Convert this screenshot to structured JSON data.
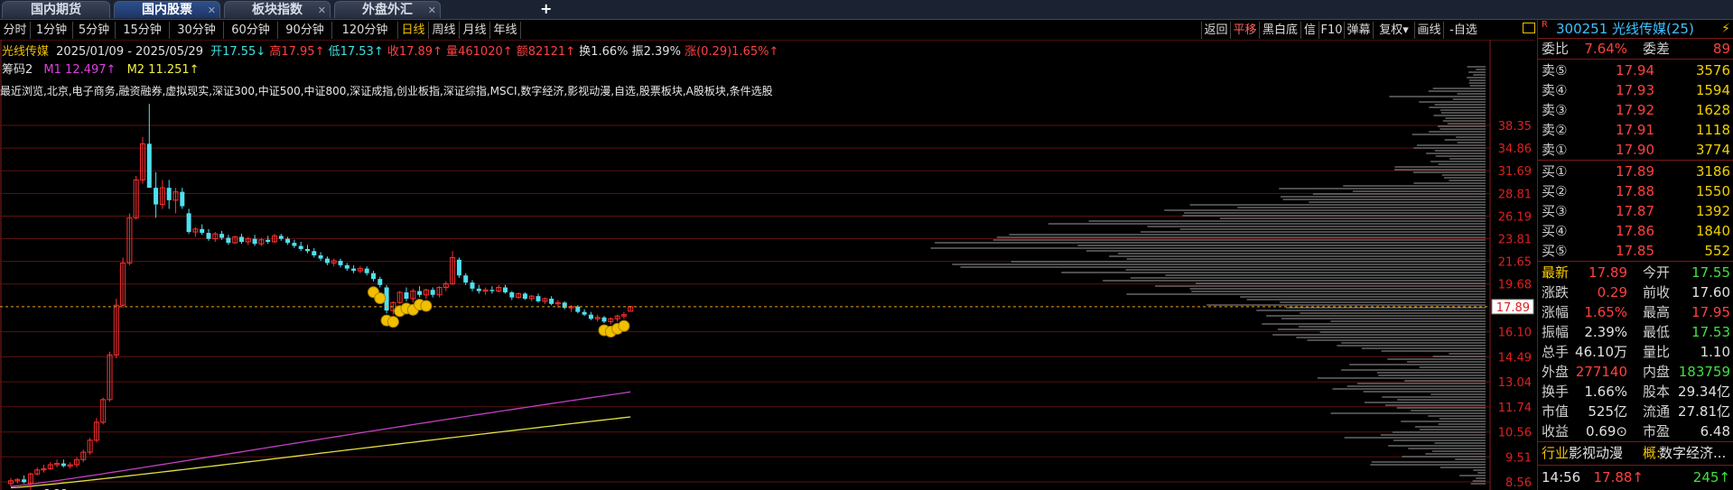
{
  "tabs": [
    {
      "label": "国内期货",
      "active": false,
      "closable": false
    },
    {
      "label": "国内股票",
      "active": true,
      "closable": true
    },
    {
      "label": "板块指数",
      "active": false,
      "closable": true
    },
    {
      "label": "外盘外汇",
      "active": false,
      "closable": true
    }
  ],
  "add_tab": "+",
  "periods": [
    "分时",
    "1分钟",
    "5分钟",
    "15分钟",
    "30分钟",
    "60分钟",
    "90分钟",
    "120分钟",
    "日线",
    "周线",
    "月线",
    "年线"
  ],
  "active_period": "日线",
  "tools": [
    "返回",
    "平移",
    "黑白底",
    "信",
    "F10",
    "弹幕",
    "复权▾",
    "画线",
    "-自选"
  ],
  "highlight_tool": "平移",
  "info": {
    "name": "光线传媒",
    "range": "2025/01/09 - 2025/05/29",
    "open": "开17.55↓",
    "high": "高17.95↑",
    "low": "低17.53↑",
    "close": "收17.89↑",
    "volume": "量461020↑",
    "amount": "额82121↑",
    "turnover": "换1.66%",
    "amplitude": "振2.39%",
    "change": "涨(0.29)1.65%↑"
  },
  "ma": {
    "label": "筹码2",
    "m1": "M1 12.497↑",
    "m2": "M2 11.251↑"
  },
  "blocks": "最近浏览,北京,电子商务,融资融券,虚拟现实,深证300,中证500,中证800,深证成指,创业板指,深证综指,MSCI,数字经济,影视动漫,自选,股票板块,A股板块,条件选股",
  "chart_data": {
    "type": "candlestick",
    "price_ticks": [
      "38.35",
      "34.86",
      "31.69",
      "28.81",
      "26.19",
      "23.81",
      "21.65",
      "19.68",
      "17.89",
      "16.10",
      "14.49",
      "13.04",
      "11.74",
      "10.56",
      "9.51",
      "8.56"
    ],
    "current_price": "17.89",
    "low_label": "8.28",
    "candles": [
      [
        8.5,
        8.7,
        8.4,
        8.6
      ],
      [
        8.6,
        8.7,
        8.5,
        8.65
      ],
      [
        8.65,
        8.8,
        8.5,
        8.55
      ],
      [
        8.5,
        8.9,
        8.28,
        8.85
      ],
      [
        8.85,
        9.1,
        8.8,
        9.0
      ],
      [
        9.0,
        9.2,
        8.9,
        9.05
      ],
      [
        9.05,
        9.3,
        9.0,
        9.2
      ],
      [
        9.2,
        9.4,
        9.1,
        9.25
      ],
      [
        9.25,
        9.4,
        9.1,
        9.15
      ],
      [
        9.15,
        9.3,
        9.05,
        9.2
      ],
      [
        9.2,
        9.5,
        9.1,
        9.4
      ],
      [
        9.4,
        9.8,
        9.3,
        9.7
      ],
      [
        9.7,
        10.3,
        9.6,
        10.2
      ],
      [
        10.2,
        11.2,
        10.1,
        11.0
      ],
      [
        11.0,
        12.2,
        10.9,
        12.1
      ],
      [
        12.1,
        14.8,
        12.0,
        14.6
      ],
      [
        14.6,
        18.5,
        14.4,
        18.0
      ],
      [
        18.0,
        22.0,
        17.8,
        21.5
      ],
      [
        21.5,
        26.5,
        21.3,
        26.0
      ],
      [
        26.0,
        31.0,
        25.8,
        30.5
      ],
      [
        30.5,
        36.5,
        30.0,
        35.5
      ],
      [
        35.5,
        42.0,
        34.0,
        29.5
      ],
      [
        29.5,
        31.5,
        26.0,
        27.5
      ],
      [
        27.5,
        30.5,
        27.0,
        29.5
      ],
      [
        29.5,
        30.5,
        27.0,
        28.0
      ],
      [
        28.0,
        29.5,
        26.5,
        29.0
      ],
      [
        29.0,
        29.5,
        27.0,
        27.3
      ],
      [
        26.5,
        27.0,
        24.3,
        24.5
      ],
      [
        24.5,
        25.0,
        24.0,
        24.8
      ],
      [
        24.8,
        25.3,
        24.2,
        24.4
      ],
      [
        24.4,
        24.8,
        23.6,
        23.8
      ],
      [
        23.8,
        24.5,
        23.5,
        24.3
      ],
      [
        24.3,
        24.6,
        23.7,
        23.9
      ],
      [
        23.9,
        24.2,
        23.2,
        23.4
      ],
      [
        23.4,
        24.1,
        23.3,
        24.0
      ],
      [
        24.0,
        24.3,
        23.3,
        23.5
      ],
      [
        23.5,
        24.0,
        23.2,
        23.8
      ],
      [
        23.8,
        24.2,
        23.1,
        23.3
      ],
      [
        23.3,
        23.9,
        23.1,
        23.7
      ],
      [
        23.7,
        24.1,
        23.3,
        23.5
      ],
      [
        23.5,
        24.3,
        23.4,
        24.1
      ],
      [
        24.1,
        24.3,
        23.6,
        23.8
      ],
      [
        23.8,
        24.0,
        23.2,
        23.4
      ],
      [
        23.4,
        23.7,
        22.9,
        23.1
      ],
      [
        23.1,
        23.5,
        22.6,
        22.8
      ],
      [
        22.8,
        23.2,
        22.4,
        22.6
      ],
      [
        22.6,
        22.9,
        22.0,
        22.2
      ],
      [
        22.2,
        22.5,
        21.7,
        21.9
      ],
      [
        21.9,
        22.1,
        21.3,
        21.5
      ],
      [
        21.5,
        21.9,
        21.2,
        21.7
      ],
      [
        21.7,
        21.9,
        21.1,
        21.3
      ],
      [
        21.3,
        21.5,
        20.8,
        21.0
      ],
      [
        21.0,
        21.3,
        20.6,
        20.8
      ],
      [
        20.8,
        21.2,
        20.6,
        21.0
      ],
      [
        21.0,
        21.2,
        20.4,
        20.6
      ],
      [
        20.6,
        20.8,
        19.9,
        20.1
      ],
      [
        20.1,
        20.3,
        19.4,
        19.6
      ],
      [
        19.4,
        19.6,
        17.4,
        17.6
      ],
      [
        17.6,
        18.3,
        17.3,
        18.2
      ],
      [
        18.2,
        19.1,
        18.1,
        19.0
      ],
      [
        19.0,
        19.4,
        18.3,
        18.5
      ],
      [
        18.5,
        19.3,
        18.2,
        19.1
      ],
      [
        19.1,
        19.5,
        18.6,
        18.8
      ],
      [
        18.8,
        19.3,
        18.5,
        19.2
      ],
      [
        19.2,
        19.4,
        18.6,
        18.8
      ],
      [
        18.8,
        19.5,
        18.6,
        19.4
      ],
      [
        19.4,
        19.9,
        19.1,
        19.7
      ],
      [
        19.7,
        22.6,
        19.6,
        22.0
      ],
      [
        21.8,
        22.0,
        20.2,
        20.4
      ],
      [
        20.4,
        20.6,
        19.6,
        19.8
      ],
      [
        19.8,
        20.0,
        19.1,
        19.3
      ],
      [
        19.3,
        19.6,
        18.9,
        19.1
      ],
      [
        19.1,
        19.4,
        18.8,
        19.2
      ],
      [
        19.2,
        19.5,
        18.9,
        19.1
      ],
      [
        19.1,
        19.6,
        19.0,
        19.4
      ],
      [
        19.4,
        19.6,
        18.9,
        19.0
      ],
      [
        19.0,
        19.1,
        18.4,
        18.6
      ],
      [
        18.6,
        19.0,
        18.5,
        18.9
      ],
      [
        18.9,
        19.0,
        18.4,
        18.5
      ],
      [
        18.5,
        18.8,
        18.3,
        18.7
      ],
      [
        18.7,
        18.9,
        18.2,
        18.3
      ],
      [
        18.3,
        18.6,
        18.1,
        18.5
      ],
      [
        18.5,
        18.7,
        18.0,
        18.1
      ],
      [
        18.1,
        18.4,
        17.8,
        18.2
      ],
      [
        18.2,
        18.3,
        17.7,
        17.8
      ],
      [
        17.8,
        18.0,
        17.5,
        17.9
      ],
      [
        17.9,
        18.0,
        17.4,
        17.5
      ],
      [
        17.5,
        17.7,
        17.2,
        17.3
      ],
      [
        17.3,
        17.5,
        16.9,
        17.0
      ],
      [
        17.0,
        17.3,
        16.8,
        17.1
      ],
      [
        17.1,
        17.2,
        16.7,
        16.8
      ],
      [
        16.8,
        17.1,
        16.6,
        17.0
      ],
      [
        17.0,
        17.3,
        16.8,
        17.2
      ],
      [
        17.2,
        17.5,
        17.0,
        17.3
      ],
      [
        17.55,
        17.95,
        17.53,
        17.89
      ]
    ],
    "ma_series": [
      {
        "name": "M1",
        "color": "#c040c0",
        "start": 8.4,
        "end": 12.497
      },
      {
        "name": "M2",
        "color": "#e0e040",
        "start": 8.35,
        "end": 11.251
      }
    ]
  },
  "quote": {
    "title_code": "300251 光线传媒(25)",
    "weibi_label": "委比",
    "weibi": "7.64%",
    "weicha_label": "委差",
    "weicha": "89",
    "asks": [
      {
        "label": "卖⑤",
        "price": "17.94",
        "vol": "3576"
      },
      {
        "label": "卖④",
        "price": "17.93",
        "vol": "1594"
      },
      {
        "label": "卖③",
        "price": "17.92",
        "vol": "1628"
      },
      {
        "label": "卖②",
        "price": "17.91",
        "vol": "1118"
      },
      {
        "label": "卖①",
        "price": "17.90",
        "vol": "3774"
      }
    ],
    "bids": [
      {
        "label": "买①",
        "price": "17.89",
        "vol": "3186"
      },
      {
        "label": "买②",
        "price": "17.88",
        "vol": "1550"
      },
      {
        "label": "买③",
        "price": "17.87",
        "vol": "1392"
      },
      {
        "label": "买④",
        "price": "17.86",
        "vol": "1840"
      },
      {
        "label": "买⑤",
        "price": "17.85",
        "vol": "552"
      }
    ],
    "stats": [
      [
        {
          "l": "最新",
          "v": "17.89",
          "c": "#ff4040",
          "lc": "#ffd000"
        },
        {
          "l": "今开",
          "v": "17.55",
          "c": "#40e040"
        }
      ],
      [
        {
          "l": "涨跌",
          "v": "0.29",
          "c": "#ff4040"
        },
        {
          "l": "前收",
          "v": "17.60",
          "c": "#e0e0e0"
        }
      ],
      [
        {
          "l": "涨幅",
          "v": "1.65%",
          "c": "#ff4040"
        },
        {
          "l": "最高",
          "v": "17.95",
          "c": "#ff4040"
        }
      ],
      [
        {
          "l": "振幅",
          "v": "2.39%",
          "c": "#e0e0e0"
        },
        {
          "l": "最低",
          "v": "17.53",
          "c": "#40e040"
        }
      ],
      [
        {
          "l": "总手",
          "v": "46.10万",
          "c": "#e0e0e0"
        },
        {
          "l": "量比",
          "v": "1.10",
          "c": "#e0e0e0"
        }
      ],
      [
        {
          "l": "外盘",
          "v": "277140",
          "c": "#ff4040"
        },
        {
          "l": "内盘",
          "v": "183759",
          "c": "#40e040"
        }
      ],
      [
        {
          "l": "换手",
          "v": "1.66%",
          "c": "#e0e0e0"
        },
        {
          "l": "股本",
          "v": "29.34亿",
          "c": "#e0e0e0"
        }
      ],
      [
        {
          "l": "市值",
          "v": "525亿",
          "c": "#e0e0e0"
        },
        {
          "l": "流通",
          "v": "27.81亿",
          "c": "#e0e0e0"
        }
      ],
      [
        {
          "l": "收益",
          "v": "0.69⊙",
          "c": "#e0e0e0"
        },
        {
          "l": "市盈",
          "v": "6.48",
          "c": "#e0e0e0"
        }
      ]
    ],
    "industry_label": "行业",
    "industry": "影视动漫",
    "concept_label": "概:",
    "concept": "数字经济...",
    "tick_time": "14:56",
    "tick_price": "17.88↑",
    "tick_vol": "245↑"
  }
}
